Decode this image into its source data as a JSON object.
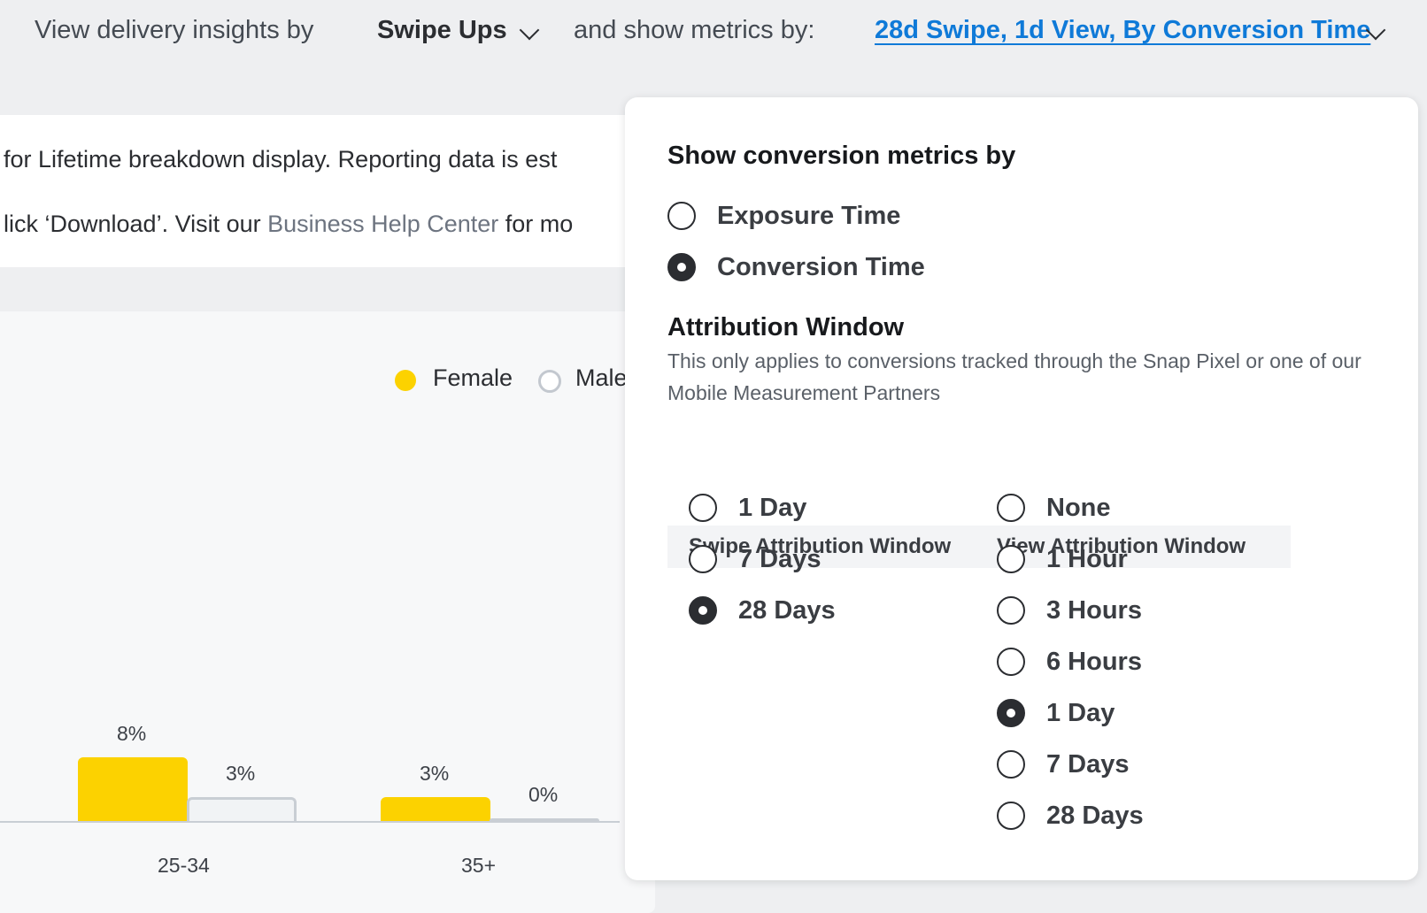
{
  "topbar": {
    "prefix": "View delivery insights by",
    "metric_value": "Swipe Ups",
    "middle": "and show metrics by:",
    "settings_value": "28d Swipe, 1d View, By Conversion Time",
    "link_color": "#0f7ad8"
  },
  "banner": {
    "line1": "for Lifetime breakdown display. Reporting data is est",
    "line2_pre": "lick ‘Download’. Visit our ",
    "line2_link": "Business Help Center",
    "line2_post": " for mo"
  },
  "chart_data": {
    "type": "bar",
    "categories": [
      "25-34",
      "35+"
    ],
    "series": [
      {
        "name": "Female",
        "values": [
          8,
          3
        ],
        "labels": [
          "8%",
          "3%"
        ],
        "color": "#fcd200"
      },
      {
        "name": "Male",
        "values": [
          3,
          0
        ],
        "labels": [
          "3%",
          "0%"
        ],
        "color": "#c9ced4"
      }
    ],
    "legend_position": "top-right",
    "unit": "%"
  },
  "popover": {
    "heading": "Show conversion metrics by",
    "time_options": [
      {
        "label": "Exposure Time",
        "selected": false
      },
      {
        "label": "Conversion Time",
        "selected": true
      }
    ],
    "attribution_heading": "Attribution Window",
    "attribution_desc": "This only applies to conversions tracked through the Snap Pixel or one of our Mobile Measurement Partners",
    "swipe_header": "Swipe Attribution Window",
    "view_header": "View Attribution Window",
    "swipe_options": [
      {
        "label": "1 Day",
        "selected": false
      },
      {
        "label": "7 Days",
        "selected": false
      },
      {
        "label": "28 Days",
        "selected": true
      }
    ],
    "view_options": [
      {
        "label": "None",
        "selected": false
      },
      {
        "label": "1 Hour",
        "selected": false
      },
      {
        "label": "3 Hours",
        "selected": false
      },
      {
        "label": "6 Hours",
        "selected": false
      },
      {
        "label": "1 Day",
        "selected": true
      },
      {
        "label": "7 Days",
        "selected": false
      },
      {
        "label": "28 Days",
        "selected": false
      }
    ]
  }
}
